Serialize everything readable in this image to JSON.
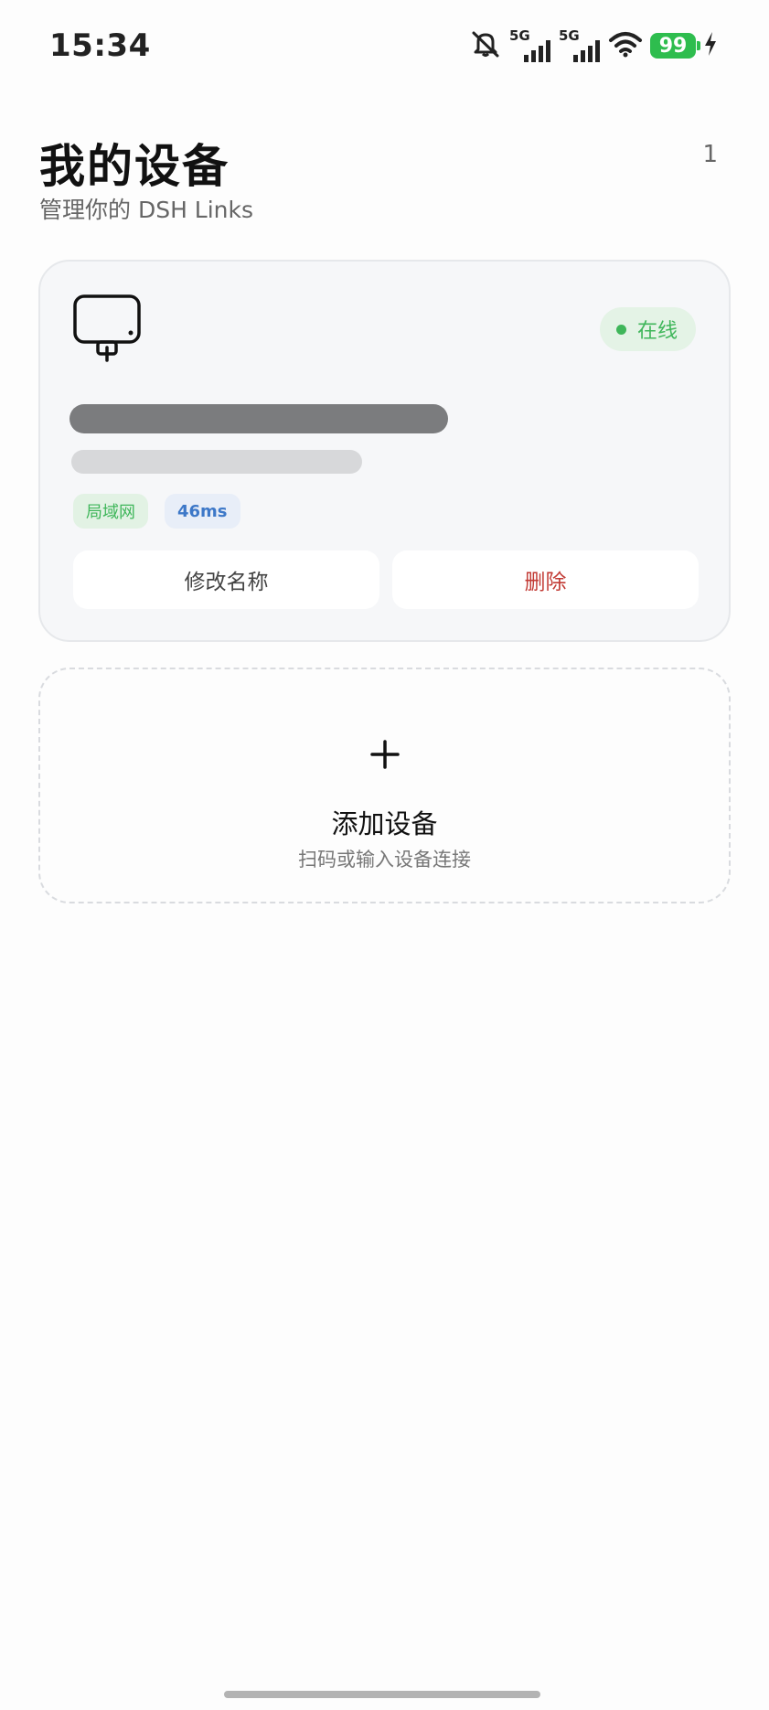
{
  "status_bar": {
    "time": "15:34",
    "network_1": "5G",
    "network_2": "5G",
    "battery": "99",
    "battery_color": "#2ebd4e"
  },
  "header": {
    "title": "我的设备",
    "subtitle": "管理你的 DSH Links",
    "count": "1"
  },
  "devices": [
    {
      "icon": "monitor-icon",
      "status": "在线",
      "status_color": "#3fb65a",
      "connection_tag": "局域网",
      "latency": "46ms",
      "rename_label": "修改名称",
      "delete_label": "删除",
      "delete_color": "#c23a34"
    }
  ],
  "add_device": {
    "icon": "plus-icon",
    "title": "添加设备",
    "subtitle": "扫码或输入设备连接"
  }
}
